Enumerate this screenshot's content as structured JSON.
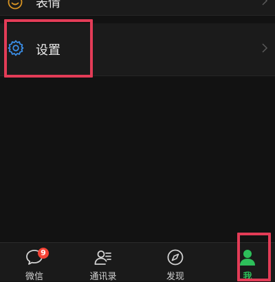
{
  "menu": {
    "emoji_row": {
      "label": "表情",
      "icon": "emoji-face-icon",
      "icon_color": "#d89423"
    },
    "settings_row": {
      "label": "设置",
      "icon": "gear-icon",
      "icon_color": "#3b8fe8"
    }
  },
  "tabbar": {
    "tabs": [
      {
        "label": "微信",
        "icon": "chat-bubble-icon",
        "badge": "9"
      },
      {
        "label": "通讯录",
        "icon": "contacts-icon"
      },
      {
        "label": "发现",
        "icon": "compass-icon"
      },
      {
        "label": "我",
        "icon": "person-icon",
        "active": true
      }
    ],
    "active_color": "#2dbf5a",
    "badge_color": "#f44336"
  },
  "annotation_color": "#e33c57"
}
